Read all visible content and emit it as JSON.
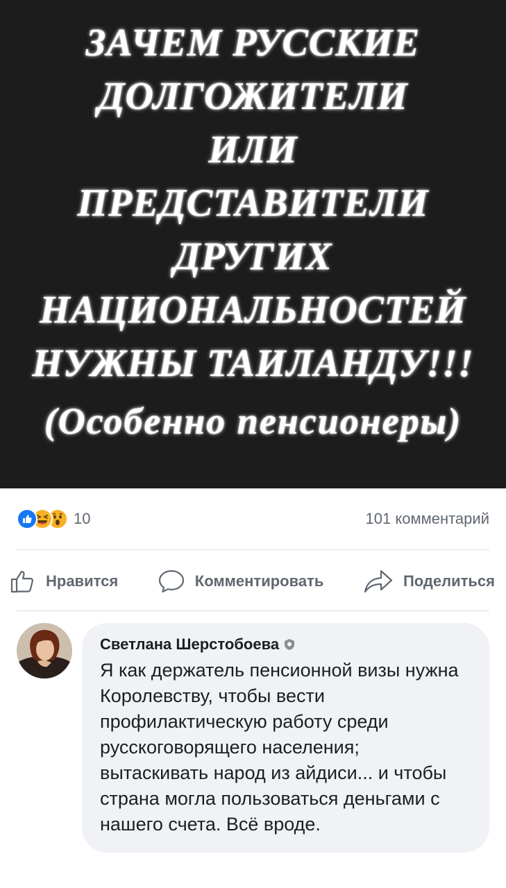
{
  "post": {
    "image_lines": [
      "ЗАЧЕМ РУССКИЕ",
      "ДОЛГОЖИТЕЛИ",
      "ИЛИ",
      "ПРЕДСТАВИТЕЛИ",
      "ДРУГИХ",
      "НАЦИОНАЛЬНОСТЕЙ",
      "НУЖНЫ ТАИЛАНДУ!!!",
      "(Особенно пенсионеры)"
    ]
  },
  "stats": {
    "reaction_count": "10",
    "comments_count": "101 комментарий",
    "reaction_icons": [
      "like-reaction-icon",
      "haha-reaction-icon",
      "wow-reaction-icon"
    ]
  },
  "actions": {
    "like": "Нравится",
    "comment": "Комментировать",
    "share": "Поделиться"
  },
  "comment": {
    "author": "Светлана Шерстобоева",
    "text": "Я как держатель пенсионной визы нужна Королевству, чтобы вести профилактическую работу среди русскоговорящего населения; вытаскивать народ из айдиси... и чтобы страна могла пользоваться деньгами с нашего счета. Всё вроде."
  },
  "colors": {
    "image_bg": "#1c1c1c",
    "like_blue": "#1877f2",
    "reaction_yellow": "#f7b125",
    "secondary_text": "#606770",
    "bubble_bg": "#f0f2f5"
  }
}
